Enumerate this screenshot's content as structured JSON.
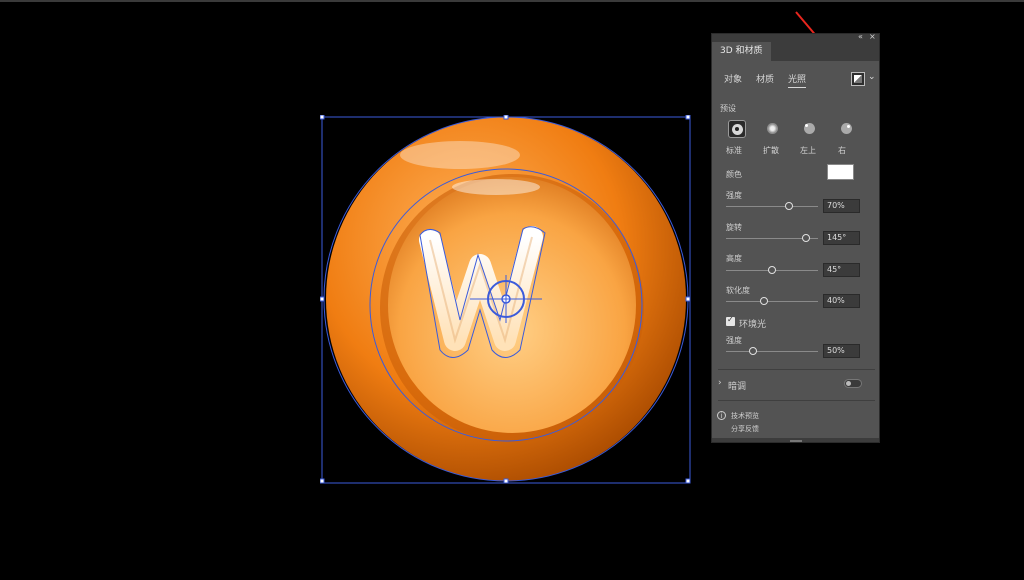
{
  "panel": {
    "title": "3D 和材质",
    "collapse_glyph": "«",
    "close_glyph": "×",
    "tabs": [
      "对象",
      "材质",
      "光照"
    ],
    "active_tab": "光照",
    "preset_label": "预设",
    "presets": [
      "标准",
      "扩散",
      "左上",
      "右"
    ],
    "selected_preset": "标准",
    "color_label": "颜色",
    "light_color": "#ffffff",
    "sliders": [
      {
        "label": "强度",
        "value": "70%",
        "level": 0.7
      },
      {
        "label": "旋转",
        "value": "145°",
        "level": 0.9
      },
      {
        "label": "高度",
        "value": "45°",
        "level": 0.5
      },
      {
        "label": "软化度",
        "value": "40%",
        "level": 0.4
      }
    ],
    "ambient": {
      "label": "环境光",
      "checked": true,
      "strength_label": "强度",
      "strength_value": "50%",
      "level": 0.27
    },
    "shadow_label": "暗调",
    "footer": {
      "line1": "技术预览",
      "line2": "分享反馈"
    }
  },
  "colors": {
    "panel_bg": "#535353",
    "accent_orange": "#f08a1e",
    "selection_blue": "#3b5bdb",
    "arrow_red": "#e8261e"
  },
  "icons": [
    "light-preset-icon",
    "chevron-down-icon",
    "info-icon",
    "chevron-right-icon",
    "toggle-switch"
  ]
}
